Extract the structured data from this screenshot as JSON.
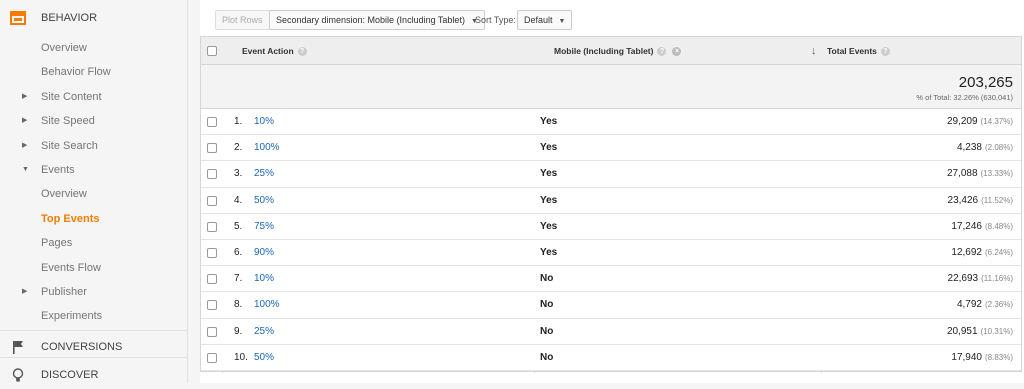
{
  "sidebar": {
    "behavior_title": "BEHAVIOR",
    "items": [
      {
        "label": "Overview",
        "caret": ""
      },
      {
        "label": "Behavior Flow",
        "caret": ""
      },
      {
        "label": "Site Content",
        "caret": "▶"
      },
      {
        "label": "Site Speed",
        "caret": "▶"
      },
      {
        "label": "Site Search",
        "caret": "▶"
      },
      {
        "label": "Events",
        "caret": "▼"
      },
      {
        "label": "Overview",
        "caret": ""
      },
      {
        "label": "Top Events",
        "caret": "",
        "active": true
      },
      {
        "label": "Pages",
        "caret": ""
      },
      {
        "label": "Events Flow",
        "caret": ""
      },
      {
        "label": "Publisher",
        "caret": "▶"
      },
      {
        "label": "Experiments",
        "caret": ""
      }
    ],
    "conversions_title": "CONVERSIONS",
    "discover_title": "DISCOVER",
    "accent_color": "#f57c00"
  },
  "toolbar": {
    "plot_rows_label": "Plot Rows",
    "secondary_dimension_label": "Secondary dimension: Mobile (Including Tablet)",
    "sort_type_label": "Sort Type:",
    "sort_type_value": "Default"
  },
  "table": {
    "col_event_action": "Event Action",
    "col_mobile": "Mobile (Including Tablet)",
    "col_total_events": "Total Events",
    "totals": {
      "value": "203,265",
      "note": "% of Total: 32.26% (630,041)"
    },
    "rows": [
      {
        "num": "1.",
        "action": "10%",
        "mobile": "Yes",
        "total": "29,209",
        "pct": "(14.37%)"
      },
      {
        "num": "2.",
        "action": "100%",
        "mobile": "Yes",
        "total": "4,238",
        "pct": "(2.08%)"
      },
      {
        "num": "3.",
        "action": "25%",
        "mobile": "Yes",
        "total": "27,088",
        "pct": "(13.33%)"
      },
      {
        "num": "4.",
        "action": "50%",
        "mobile": "Yes",
        "total": "23,426",
        "pct": "(11.52%)"
      },
      {
        "num": "5.",
        "action": "75%",
        "mobile": "Yes",
        "total": "17,246",
        "pct": "(8.48%)"
      },
      {
        "num": "6.",
        "action": "90%",
        "mobile": "Yes",
        "total": "12,692",
        "pct": "(6.24%)"
      },
      {
        "num": "7.",
        "action": "10%",
        "mobile": "No",
        "total": "22,693",
        "pct": "(11.16%)"
      },
      {
        "num": "8.",
        "action": "100%",
        "mobile": "No",
        "total": "4,792",
        "pct": "(2.36%)"
      },
      {
        "num": "9.",
        "action": "25%",
        "mobile": "No",
        "total": "20,951",
        "pct": "(10.31%)"
      },
      {
        "num": "10.",
        "action": "50%",
        "mobile": "No",
        "total": "17,940",
        "pct": "(8.83%)"
      }
    ]
  }
}
